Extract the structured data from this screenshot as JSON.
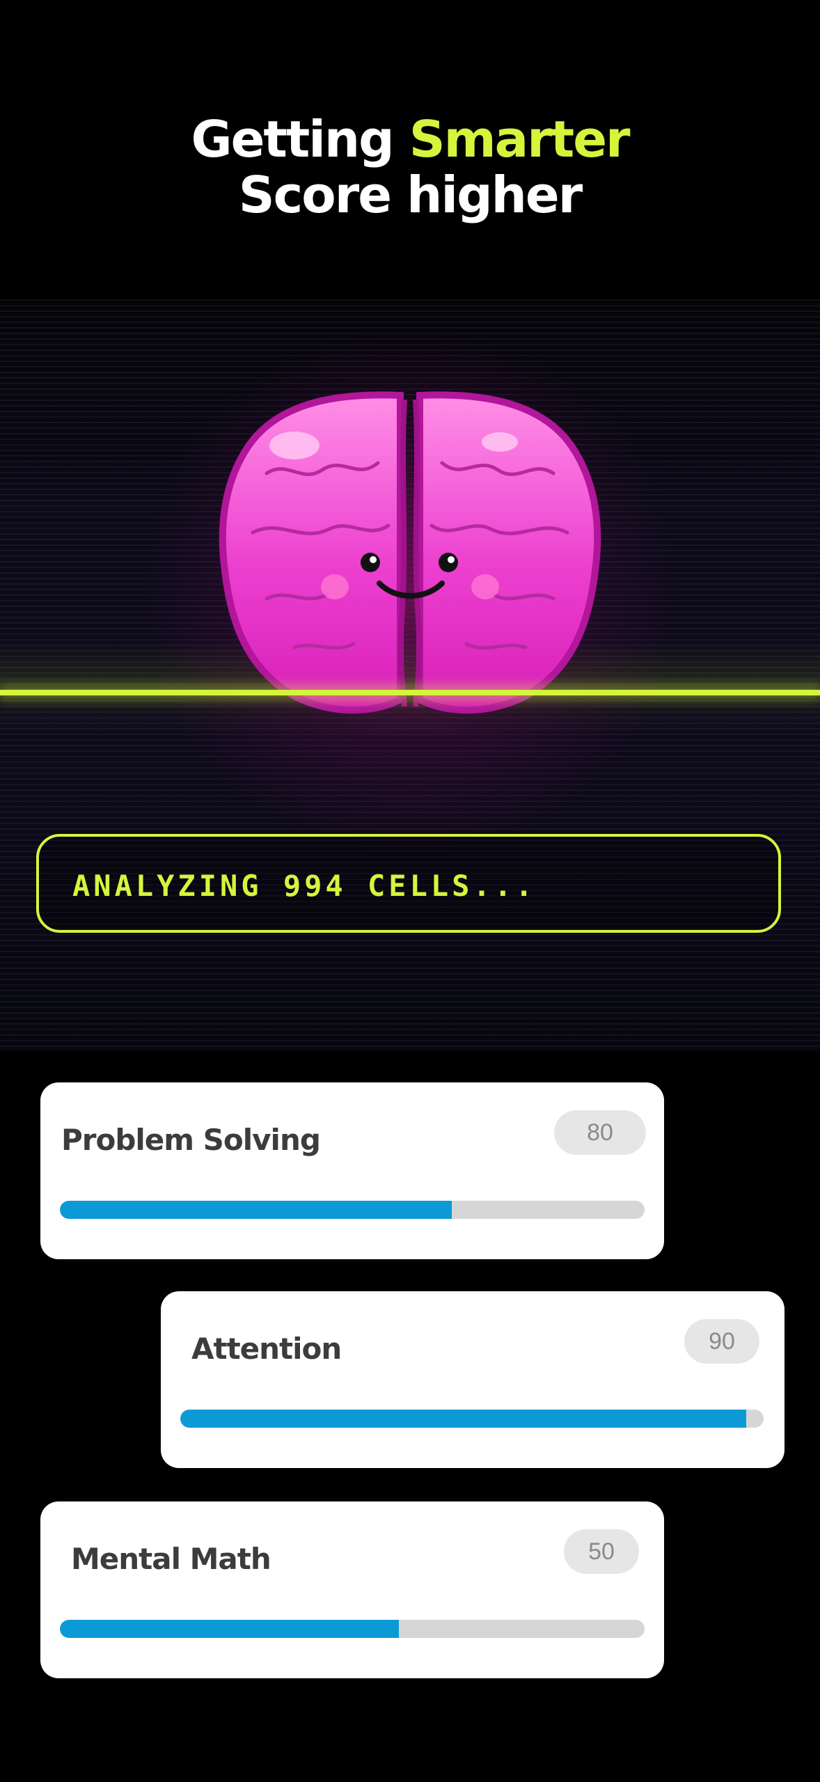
{
  "headline": {
    "line1_prefix": "Getting",
    "line1_accent": "Smarter",
    "line2": "Score higher"
  },
  "status": {
    "text": "ANALYZING 994 CELLS..."
  },
  "colors": {
    "accent": "#d4f53c",
    "brain": "#e63cc8",
    "progress": "#0c9ad6"
  },
  "skills": [
    {
      "label": "Problem Solving",
      "score": "80",
      "progress": 0.67
    },
    {
      "label": "Attention",
      "score": "90",
      "progress": 0.97
    },
    {
      "label": "Mental Math",
      "score": "50",
      "progress": 0.58
    }
  ]
}
